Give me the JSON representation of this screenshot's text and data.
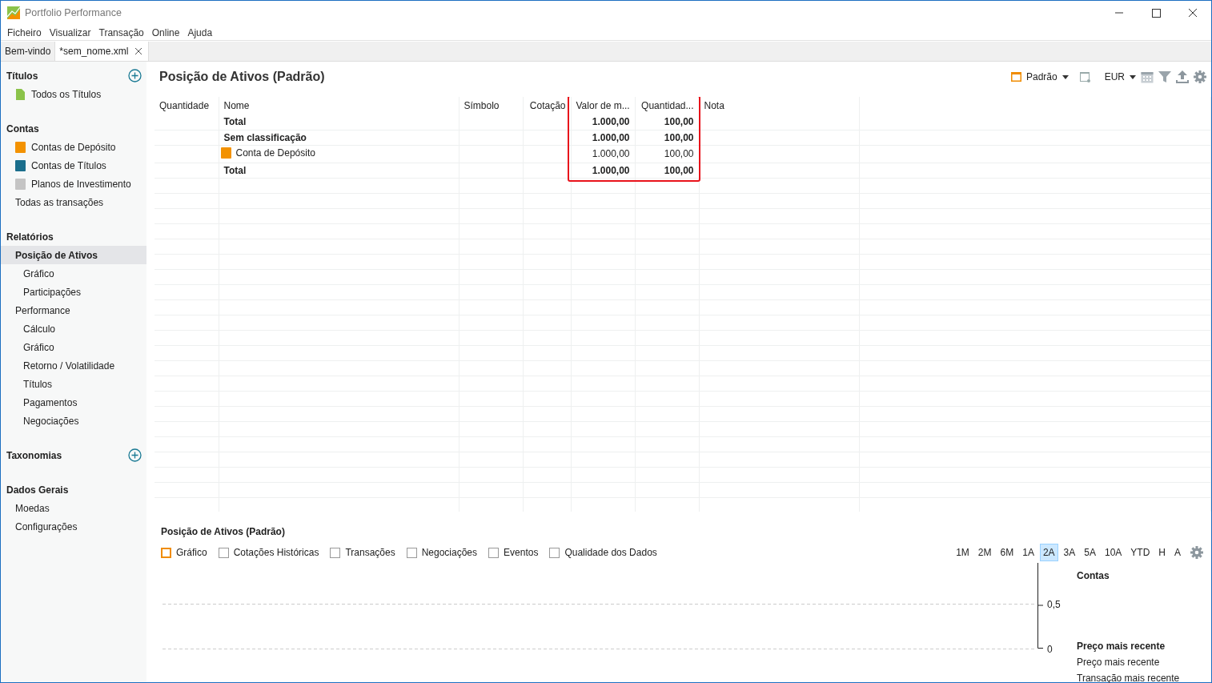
{
  "window": {
    "title": "Portfolio Performance"
  },
  "menu": [
    "Ficheiro",
    "Visualizar",
    "Transação",
    "Online",
    "Ajuda"
  ],
  "tabs": [
    {
      "label": "Bem-vindo",
      "selected": false,
      "closable": false
    },
    {
      "label": "*sem_nome.xml",
      "selected": true,
      "closable": true
    }
  ],
  "sidebar": [
    {
      "title": "Títulos",
      "addable": true,
      "items": [
        {
          "label": "Todos os Títulos",
          "kind": "security",
          "selected": false
        }
      ]
    },
    {
      "title": "Contas",
      "addable": false,
      "items": [
        {
          "label": "Contas de Depósito",
          "kind": "deposit",
          "selected": false
        },
        {
          "label": "Contas de Títulos",
          "kind": "securities",
          "selected": false
        },
        {
          "label": "Planos de Investimento",
          "kind": "plan",
          "selected": false
        },
        {
          "label": "Todas as transações",
          "selected": false
        }
      ]
    },
    {
      "title": "Relatórios",
      "addable": false,
      "items": [
        {
          "label": "Posição de Ativos",
          "selected": true,
          "children": [
            {
              "label": "Gráfico",
              "selected": false
            },
            {
              "label": "Participações",
              "selected": false
            }
          ]
        },
        {
          "label": "Performance",
          "selected": false,
          "children": [
            {
              "label": "Cálculo",
              "selected": false
            },
            {
              "label": "Gráfico",
              "selected": false
            },
            {
              "label": "Retorno / Volatilidade",
              "selected": false
            },
            {
              "label": "Títulos",
              "selected": false
            },
            {
              "label": "Pagamentos",
              "selected": false
            },
            {
              "label": "Negociações",
              "selected": false
            }
          ]
        }
      ]
    },
    {
      "title": "Taxonomias",
      "addable": true
    },
    {
      "title": "Dados Gerais",
      "addable": false,
      "items": [
        {
          "label": "Moedas",
          "selected": false
        },
        {
          "label": "Configurações",
          "selected": false
        }
      ]
    }
  ],
  "page": {
    "title": "Posição de Ativos (Padrão)",
    "view": "Padrão",
    "currency": "EUR"
  },
  "table": {
    "columns": [
      {
        "label": "Quantidade",
        "highlighted": false
      },
      {
        "label": "Nome",
        "highlighted": false
      },
      {
        "label": "Símbolo",
        "highlighted": false
      },
      {
        "label": "Cotação",
        "highlighted": false
      },
      {
        "label": "Valor de m...",
        "highlighted": true
      },
      {
        "label": "Quantidad...",
        "highlighted": true
      },
      {
        "label": "Nota",
        "highlighted": false
      }
    ],
    "rows": [
      {
        "cells": [
          "",
          "Total",
          "",
          "",
          "1.000,00",
          "100,00",
          ""
        ],
        "bold": true
      },
      {
        "cells": [
          "",
          "Sem classificação",
          "",
          "",
          "1.000,00",
          "100,00",
          ""
        ],
        "bold": true
      },
      {
        "cells": [
          "",
          "Conta de Depósito",
          "",
          "",
          "1.000,00",
          "100,00",
          ""
        ],
        "bold": false,
        "kind": "deposit"
      },
      {
        "cells": [
          "",
          "Total",
          "",
          "",
          "1.000,00",
          "100,00",
          ""
        ],
        "bold": true
      }
    ]
  },
  "bottom": {
    "title": "Posição de Ativos (Padrão)",
    "tabs": [
      {
        "label": "Gráfico",
        "selected": true
      },
      {
        "label": "Cotações Históricas",
        "selected": false
      },
      {
        "label": "Transações",
        "selected": false
      },
      {
        "label": "Negociações",
        "selected": false
      },
      {
        "label": "Eventos",
        "selected": false
      },
      {
        "label": "Qualidade dos Dados",
        "selected": false
      }
    ],
    "periods": [
      {
        "label": "1M",
        "selected": false
      },
      {
        "label": "2M",
        "selected": false
      },
      {
        "label": "6M",
        "selected": false
      },
      {
        "label": "1A",
        "selected": false
      },
      {
        "label": "2A",
        "selected": true
      },
      {
        "label": "3A",
        "selected": false
      },
      {
        "label": "5A",
        "selected": false
      },
      {
        "label": "10A",
        "selected": false
      },
      {
        "label": "YTD",
        "selected": false
      },
      {
        "label": "H",
        "selected": false
      },
      {
        "label": "A",
        "selected": false
      }
    ],
    "y_ticks": [
      "0,5",
      "0"
    ],
    "legend": [
      {
        "text": "Contas",
        "bold": true
      },
      {
        "text": "Preço mais recente",
        "bold": true
      },
      {
        "text": "Preço mais recente",
        "bold": false
      },
      {
        "text": "Transação mais recente",
        "bold": false
      }
    ]
  }
}
